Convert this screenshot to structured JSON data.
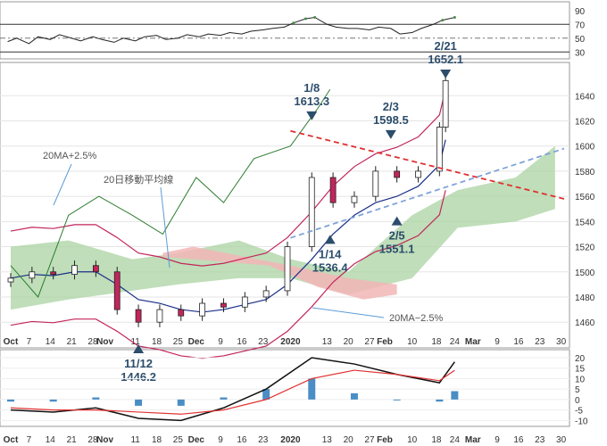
{
  "chart_data": [
    {
      "panel": "rsi",
      "type": "line",
      "yticks": [
        90,
        70,
        50,
        30
      ],
      "reference_lines": [
        70,
        50,
        30
      ],
      "series": [
        {
          "x": [
            "2019-09-30",
            "2019-10-03",
            "2019-10-07",
            "2019-10-10",
            "2019-10-14",
            "2019-10-17",
            "2019-10-21",
            "2019-10-24",
            "2019-10-28",
            "2019-10-31",
            "2019-11-04",
            "2019-11-07",
            "2019-11-11",
            "2019-11-14",
            "2019-11-18",
            "2019-11-21",
            "2019-11-25",
            "2019-11-28",
            "2019-12-02",
            "2019-12-05",
            "2019-12-09",
            "2019-12-12",
            "2019-12-16",
            "2019-12-19",
            "2019-12-23",
            "2019-12-26",
            "2019-12-30",
            "2020-01-02",
            "2020-01-06",
            "2020-01-09",
            "2020-01-13",
            "2020-01-16",
            "2020-01-20",
            "2020-01-23",
            "2020-01-27",
            "2020-01-30",
            "2020-02-03",
            "2020-02-06",
            "2020-02-10",
            "2020-02-13",
            "2020-02-17",
            "2020-02-20",
            "2020-02-24"
          ],
          "values": [
            45,
            50,
            42,
            52,
            48,
            55,
            50,
            46,
            52,
            48,
            44,
            50,
            46,
            52,
            54,
            48,
            50,
            55,
            52,
            56,
            54,
            58,
            56,
            60,
            62,
            64,
            66,
            72,
            78,
            80,
            70,
            66,
            64,
            64,
            62,
            66,
            64,
            56,
            58,
            64,
            70,
            76,
            80
          ]
        }
      ]
    },
    {
      "panel": "price",
      "type": "candlestick",
      "x_ticks": [
        "Oct",
        "7",
        "14",
        "21",
        "28",
        "Nov",
        "11",
        "18",
        "25",
        "Dec",
        "9",
        "16",
        "23",
        "2020",
        "13",
        "20",
        "27",
        "Feb",
        "10",
        "18",
        "24",
        "Mar",
        "9",
        "16",
        "23",
        "30"
      ],
      "yticks": [
        1640,
        1620,
        1600,
        1580,
        1560,
        1540,
        1520,
        1500,
        1480,
        1460
      ],
      "ylim": [
        1441,
        1665
      ],
      "x": [
        "2019-10-01",
        "2019-10-08",
        "2019-10-15",
        "2019-10-22",
        "2019-10-29",
        "2019-11-05",
        "2019-11-12",
        "2019-11-19",
        "2019-11-26",
        "2019-12-03",
        "2019-12-10",
        "2019-12-17",
        "2019-12-24",
        "2019-12-31",
        "2020-01-08",
        "2020-01-15",
        "2020-01-22",
        "2020-01-29",
        "2020-02-05",
        "2020-02-12",
        "2020-02-19",
        "2020-02-21"
      ],
      "close": [
        1495,
        1500,
        1498,
        1505,
        1500,
        1470,
        1460,
        1470,
        1465,
        1475,
        1472,
        1480,
        1485,
        1520,
        1575,
        1555,
        1560,
        1580,
        1575,
        1580,
        1615,
        1652
      ],
      "ma20": [
        1495,
        1498,
        1497,
        1500,
        1500,
        1490,
        1478,
        1475,
        1470,
        1468,
        1470,
        1474,
        1478,
        1490,
        1510,
        1530,
        1545,
        1555,
        1560,
        1568,
        1585,
        1605
      ],
      "trendline_down": [
        [
          "2020-01-01",
          1612
        ],
        [
          "2020-03-31",
          1558
        ]
      ],
      "trendline_up": [
        [
          "2020-01-01",
          1527
        ],
        [
          "2020-03-31",
          1598
        ]
      ],
      "annotations": [
        {
          "text": "1/8",
          "text2": "1613.3",
          "marker": "down"
        },
        {
          "text": "2/3",
          "text2": "1598.5",
          "marker": "down"
        },
        {
          "text": "2/21",
          "text2": "1652.1",
          "marker": "down"
        },
        {
          "text": "1/14",
          "text2": "1536.4",
          "marker": "up"
        },
        {
          "text": "2/5",
          "text2": "1551.1",
          "marker": "up"
        },
        {
          "text": "11/12",
          "text2": "1446.2",
          "marker": "up"
        }
      ],
      "labels": {
        "upper_band": "20MA+2.5%",
        "ma": "20日移動平均線",
        "lower_band": "20MA−2.5%"
      }
    },
    {
      "panel": "macd",
      "type": "line",
      "yticks": [
        20,
        15,
        10,
        5,
        0,
        -5,
        -10
      ],
      "ylim": [
        -12,
        23
      ],
      "x": [
        "2019-10-01",
        "2019-10-15",
        "2019-10-29",
        "2019-11-12",
        "2019-11-26",
        "2019-12-10",
        "2019-12-24",
        "2020-01-08",
        "2020-01-22",
        "2020-02-05",
        "2020-02-19",
        "2020-02-24"
      ],
      "macd": [
        -5,
        -6,
        -4,
        -9,
        -10,
        -4,
        5,
        20,
        17,
        12,
        8,
        18
      ],
      "signal": [
        -4,
        -5,
        -5,
        -6,
        -7,
        -5,
        0,
        10,
        14,
        12,
        9,
        14
      ],
      "histogram": [
        -1,
        -1,
        1,
        -3,
        -3,
        1,
        5,
        10,
        3,
        0,
        -1,
        4
      ],
      "x_ticks": [
        "Oct",
        "7",
        "14",
        "21",
        "28",
        "Nov",
        "11",
        "18",
        "25",
        "Dec",
        "9",
        "16",
        "23",
        "2020",
        "13",
        "20",
        "27",
        "Feb",
        "10",
        "18",
        "24",
        "Mar",
        "9",
        "16",
        "23",
        "30"
      ]
    }
  ],
  "colors": {
    "up": "#2b8a3e",
    "down": "#c2255c",
    "ma": "#1b2f88",
    "band": "#c2255c",
    "cloud_up": "#a9d3a1",
    "cloud_down": "#f2b6b6",
    "trend_red": "#e03131",
    "trend_blue": "#7fa3d9",
    "marker": "#2c4d6b"
  }
}
